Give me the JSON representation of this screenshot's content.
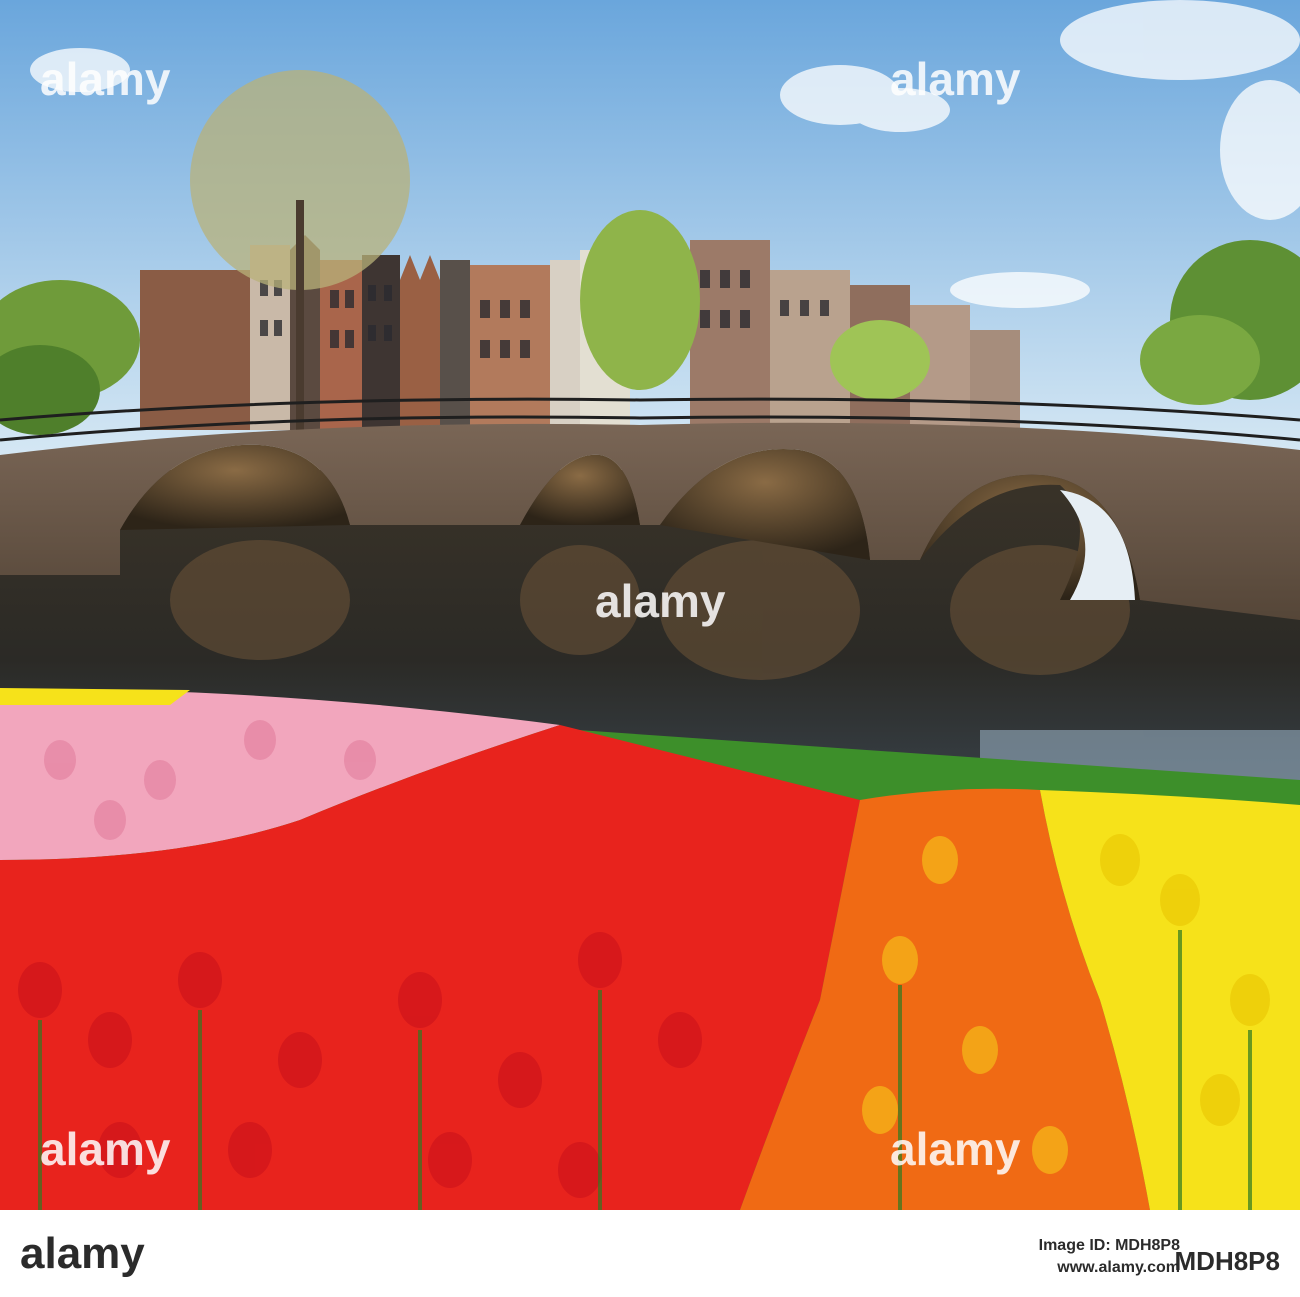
{
  "photo": {
    "subject": "canal-bridge-with-tulip-beds",
    "colors": {
      "sky_top": "#6aa6dc",
      "sky_bottom": "#cfe3f2",
      "water": "#2b2a26",
      "bridge_brick": "#6b5a4c",
      "tulip_pink": "#f2a6bd",
      "tulip_red": "#e8231d",
      "tulip_orange": "#f06a14",
      "tulip_yellow": "#f6e21a",
      "leaf_green": "#3d8f2a"
    }
  },
  "watermark": {
    "brand": "alamy",
    "stock_id": "MDH8P8"
  },
  "footer": {
    "brand": "alamy",
    "image_id_label": "Image ID: MDH8P8",
    "url": "www.alamy.com"
  }
}
